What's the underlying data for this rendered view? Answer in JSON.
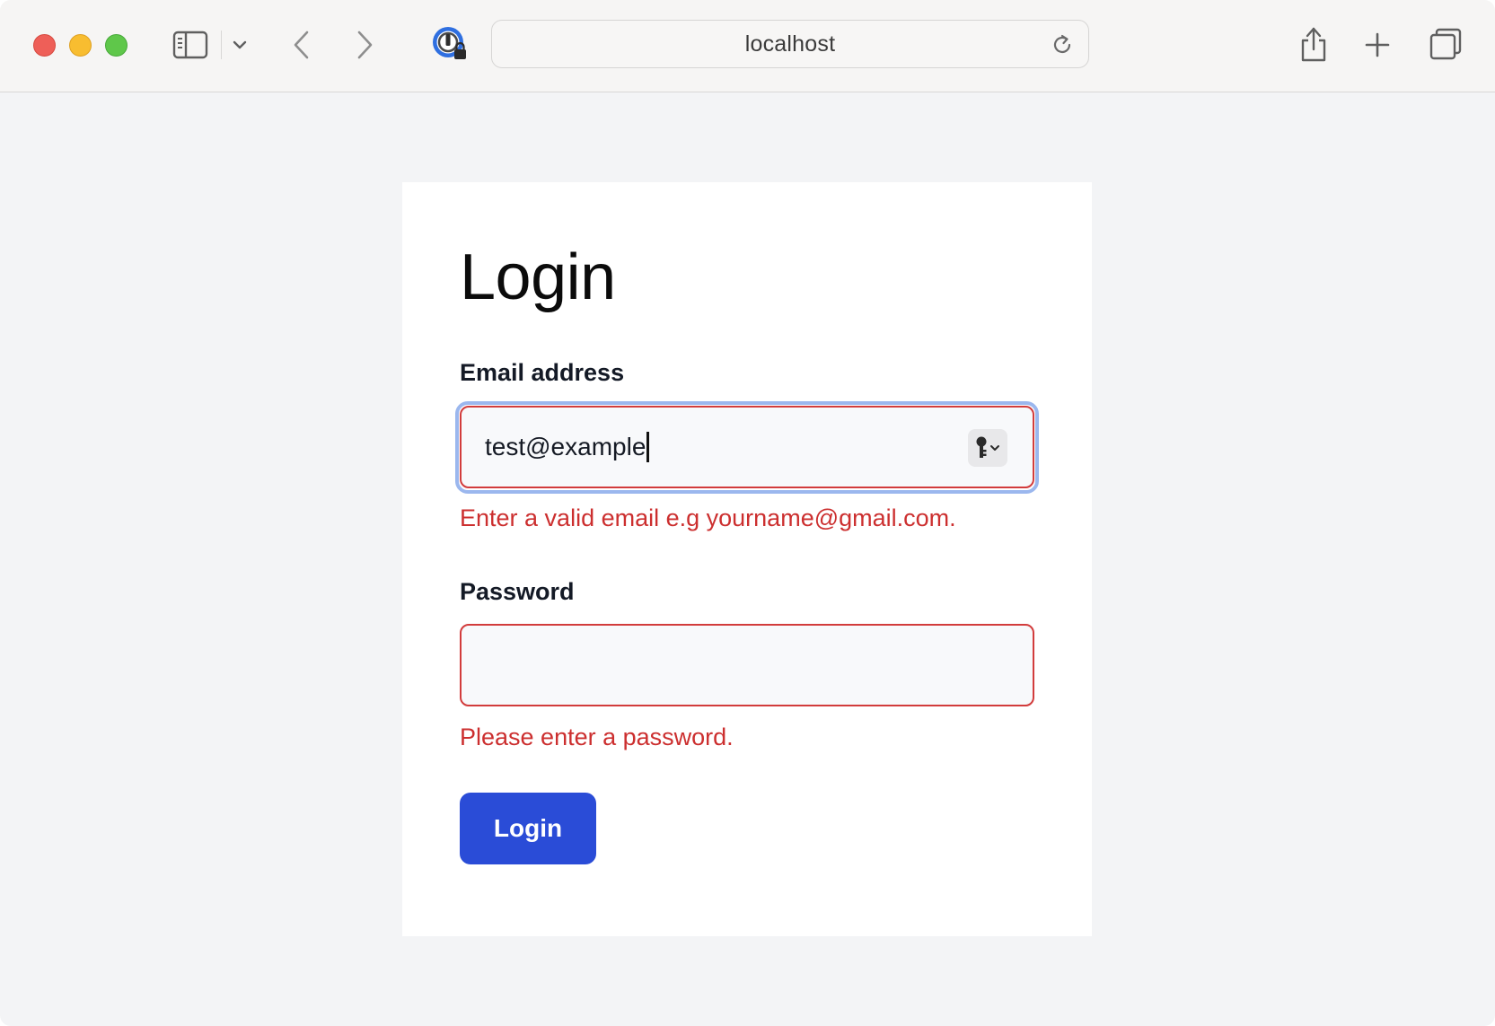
{
  "browser": {
    "address": "localhost"
  },
  "icons": {
    "sidebar_toggle": "sidebar-icon",
    "sidebar_chevron": "chevron-down-icon",
    "back": "chevron-left-icon",
    "forward": "chevron-right-icon",
    "password_manager": "password-manager-icon",
    "reload": "reload-icon",
    "share": "share-icon",
    "new_tab": "plus-icon",
    "tab_overview": "tabs-icon",
    "autofill_key": "key-icon"
  },
  "login_form": {
    "title": "Login",
    "email_label": "Email address",
    "email_value": "test@example",
    "email_error": "Enter a valid email e.g yourname@gmail.com.",
    "password_label": "Password",
    "password_value": "",
    "password_error": "Please enter a password.",
    "submit_label": "Login"
  },
  "colors": {
    "error": "#cc2f2f",
    "primary_button": "#2a4cd7",
    "focus_ring": "#9bb7ee",
    "page_background": "#f3f4f6"
  }
}
